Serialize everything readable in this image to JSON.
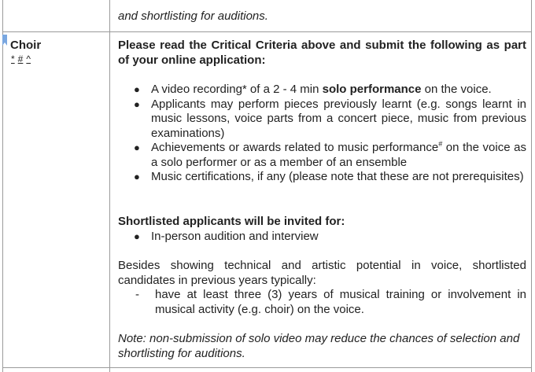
{
  "top_row": {
    "text": "and shortlisting for auditions."
  },
  "subject": {
    "name": "Choir",
    "marks": [
      "*",
      "#",
      "^"
    ]
  },
  "criteria": {
    "heading": "Please read the Critical Criteria above and submit the following as part of your online application:",
    "items": [
      {
        "pre": "A video recording* of a 2 - 4 min ",
        "bold": "solo performance",
        "post": " on the voice."
      },
      {
        "pre": "Applicants may perform pieces previously learnt (e.g. songs learnt in music lessons, voice parts from a concert piece, music from previous examinations)",
        "bold": "",
        "post": ""
      },
      {
        "pre": "Achievements or awards related to music performance",
        "sup": "#",
        "post": " on the voice as a solo performer or as a member of an ensemble"
      },
      {
        "pre": "Music certifications, if any (please note that these are not prerequisites)",
        "bold": "",
        "post": ""
      }
    ]
  },
  "shortlist": {
    "heading": "Shortlisted applicants will be invited for:",
    "items": [
      "In-person audition and interview"
    ]
  },
  "typical": {
    "intro": "Besides showing technical and artistic potential in voice, shortlisted candidates in previous years typically:",
    "items": [
      "have at least three (3) years of musical training or involvement in musical activity (e.g. choir) on the voice."
    ]
  },
  "note": {
    "text": "Note: non-submission of solo video may reduce the chances of selection and shortlisting for auditions."
  },
  "colors": {
    "border": "#9a9a9a",
    "bookmark": "#7aa7e0",
    "text": "#222222"
  }
}
